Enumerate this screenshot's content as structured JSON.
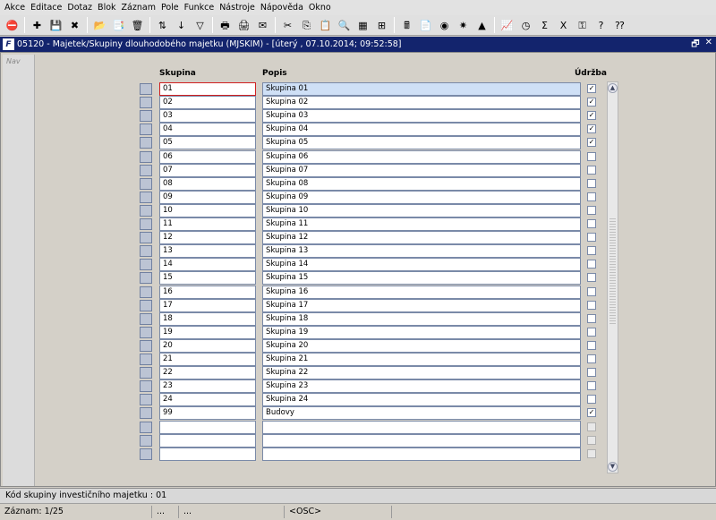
{
  "menu": [
    "Akce",
    "Editace",
    "Dotaz",
    "Blok",
    "Záznam",
    "Pole",
    "Funkce",
    "Nástroje",
    "Nápověda",
    "Okno"
  ],
  "toolbar": {
    "buttons": [
      {
        "name": "exit-icon",
        "glyph": "⛔"
      },
      {
        "sep": true
      },
      {
        "name": "new-record-icon",
        "glyph": "✚"
      },
      {
        "name": "save-icon",
        "glyph": "💾"
      },
      {
        "name": "delete-record-icon",
        "glyph": "✖"
      },
      {
        "sep": true
      },
      {
        "name": "folder-open-icon",
        "glyph": "📂"
      },
      {
        "name": "duplicate-icon",
        "glyph": "📑"
      },
      {
        "name": "clear-icon",
        "glyph": "🗑"
      },
      {
        "sep": true
      },
      {
        "name": "sort-icon",
        "glyph": "⇅"
      },
      {
        "name": "sort-down-icon",
        "glyph": "↓"
      },
      {
        "name": "filter-icon",
        "glyph": "▽"
      },
      {
        "sep": true
      },
      {
        "name": "print-icon",
        "glyph": "🖶"
      },
      {
        "name": "preview-icon",
        "glyph": "🖨"
      },
      {
        "name": "mail-icon",
        "glyph": "✉"
      },
      {
        "sep": true
      },
      {
        "name": "cut-icon",
        "glyph": "✂"
      },
      {
        "name": "copy-icon",
        "glyph": "⎘"
      },
      {
        "name": "paste-icon",
        "glyph": "📋"
      },
      {
        "name": "search-icon",
        "glyph": "🔍"
      },
      {
        "name": "grid-icon",
        "glyph": "▦"
      },
      {
        "name": "tree-icon",
        "glyph": "⊞"
      },
      {
        "sep": true
      },
      {
        "name": "calculator-icon",
        "glyph": "🖩"
      },
      {
        "name": "document-icon",
        "glyph": "📄"
      },
      {
        "name": "globe-icon",
        "glyph": "◉"
      },
      {
        "name": "star-icon",
        "glyph": "✷"
      },
      {
        "name": "triangle-icon",
        "glyph": "▲"
      },
      {
        "sep": true
      },
      {
        "name": "chart-icon",
        "glyph": "📈"
      },
      {
        "name": "clock-icon",
        "glyph": "◷"
      },
      {
        "name": "sigma-icon",
        "glyph": "Σ"
      },
      {
        "name": "excel-icon",
        "glyph": "X"
      },
      {
        "name": "key-icon",
        "glyph": "⚿"
      },
      {
        "name": "help-icon",
        "glyph": "?"
      },
      {
        "name": "context-help-icon",
        "glyph": "⁇"
      }
    ]
  },
  "window": {
    "logo": "F",
    "title": "05120 - Majetek/Skupiny dlouhodobého majetku (MJSKIM) - [úterý  , 07.10.2014; 09:52:58]",
    "restore": "🗗",
    "close": "✕"
  },
  "nav": {
    "label": "Nav"
  },
  "columns": {
    "code": "Skupina",
    "desc": "Popis",
    "maint": "Údržba"
  },
  "rows": [
    {
      "code": "01",
      "desc": "Skupina 01",
      "maint": true
    },
    {
      "code": "02",
      "desc": "Skupina 02",
      "maint": true
    },
    {
      "code": "03",
      "desc": "Skupina 03",
      "maint": true
    },
    {
      "code": "04",
      "desc": "Skupina 04",
      "maint": true
    },
    {
      "code": "05",
      "desc": "Skupina 05",
      "maint": true
    },
    {
      "code": "06",
      "desc": "Skupina 06",
      "maint": false
    },
    {
      "code": "07",
      "desc": "Skupina 07",
      "maint": false
    },
    {
      "code": "08",
      "desc": "Skupina 08",
      "maint": false
    },
    {
      "code": "09",
      "desc": "Skupina 09",
      "maint": false
    },
    {
      "code": "10",
      "desc": "Skupina 10",
      "maint": false
    },
    {
      "code": "11",
      "desc": "Skupina 11",
      "maint": false
    },
    {
      "code": "12",
      "desc": "Skupina 12",
      "maint": false
    },
    {
      "code": "13",
      "desc": "Skupina 13",
      "maint": false
    },
    {
      "code": "14",
      "desc": "Skupina 14",
      "maint": false
    },
    {
      "code": "15",
      "desc": "Skupina 15",
      "maint": false
    },
    {
      "code": "16",
      "desc": "Skupina 16",
      "maint": false
    },
    {
      "code": "17",
      "desc": "Skupina 17",
      "maint": false
    },
    {
      "code": "18",
      "desc": "Skupina 18",
      "maint": false
    },
    {
      "code": "19",
      "desc": "Skupina 19",
      "maint": false
    },
    {
      "code": "20",
      "desc": "Skupina 20",
      "maint": false
    },
    {
      "code": "21",
      "desc": "Skupina 21",
      "maint": false
    },
    {
      "code": "22",
      "desc": "Skupina 22",
      "maint": false
    },
    {
      "code": "23",
      "desc": "Skupina 23",
      "maint": false
    },
    {
      "code": "24",
      "desc": "Skupina 24",
      "maint": false
    },
    {
      "code": "99",
      "desc": "Budovy",
      "maint": true
    },
    {
      "code": "",
      "desc": "",
      "maint": null
    },
    {
      "code": "",
      "desc": "",
      "maint": null
    },
    {
      "code": "",
      "desc": "",
      "maint": null
    }
  ],
  "checkmark": "✓",
  "scroll": {
    "up": "▲",
    "down": "▼"
  },
  "status": {
    "hint": "Kód skupiny investičního majetku : 01",
    "record": "Záznam: 1/25",
    "cell2": "...",
    "cell3": "...",
    "mode": "<OSC>"
  },
  "colors": {
    "title_bg": "#13246d",
    "active_row": "#cfe0f6",
    "active_border": "#d02020"
  }
}
